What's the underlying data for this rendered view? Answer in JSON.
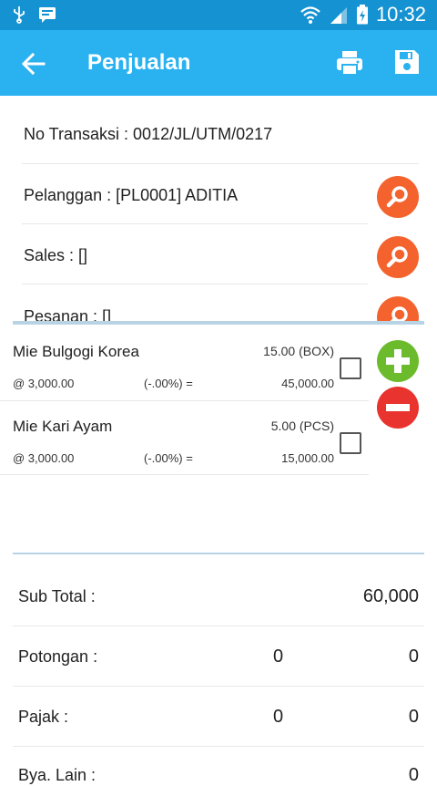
{
  "status_bar": {
    "time": "10:32"
  },
  "app_bar": {
    "title": "Penjualan"
  },
  "form": {
    "transaction": "No Transaksi : 0012/JL/UTM/0217",
    "customer": "Pelanggan : [PL0001] ADITIA",
    "sales": "Sales : []",
    "order": "Pesanan : []"
  },
  "items": [
    {
      "name": "Mie Bulgogi Korea",
      "qty": "15.00 (BOX)",
      "price": "@ 3,000.00",
      "discount": "(-.00%) =",
      "amount": "45,000.00",
      "checked": false
    },
    {
      "name": "Mie Kari Ayam",
      "qty": "5.00 (PCS)",
      "price": "@ 3,000.00",
      "discount": "(-.00%) =",
      "amount": "15,000.00",
      "checked": false
    }
  ],
  "summary": {
    "subtotal_label": "Sub Total :",
    "subtotal_value": "60,000",
    "discount_label": "Potongan :",
    "discount_pct": "0",
    "discount_value": "0",
    "tax_label": "Pajak :",
    "tax_pct": "0",
    "tax_value": "0",
    "other_label": "Bya. Lain :",
    "other_value": "0"
  },
  "colors": {
    "appbar": "#2ab2f0",
    "statusbar": "#1592d2",
    "search_fab": "#f4632d",
    "add_fab": "#6cbb2c",
    "remove_fab": "#e8332e"
  },
  "icons": [
    "usb-icon",
    "notification-icon",
    "wifi-icon",
    "signal-icon",
    "battery-icon",
    "back-arrow-icon",
    "print-icon",
    "save-icon",
    "search-icon",
    "plus-icon",
    "minus-icon"
  ]
}
